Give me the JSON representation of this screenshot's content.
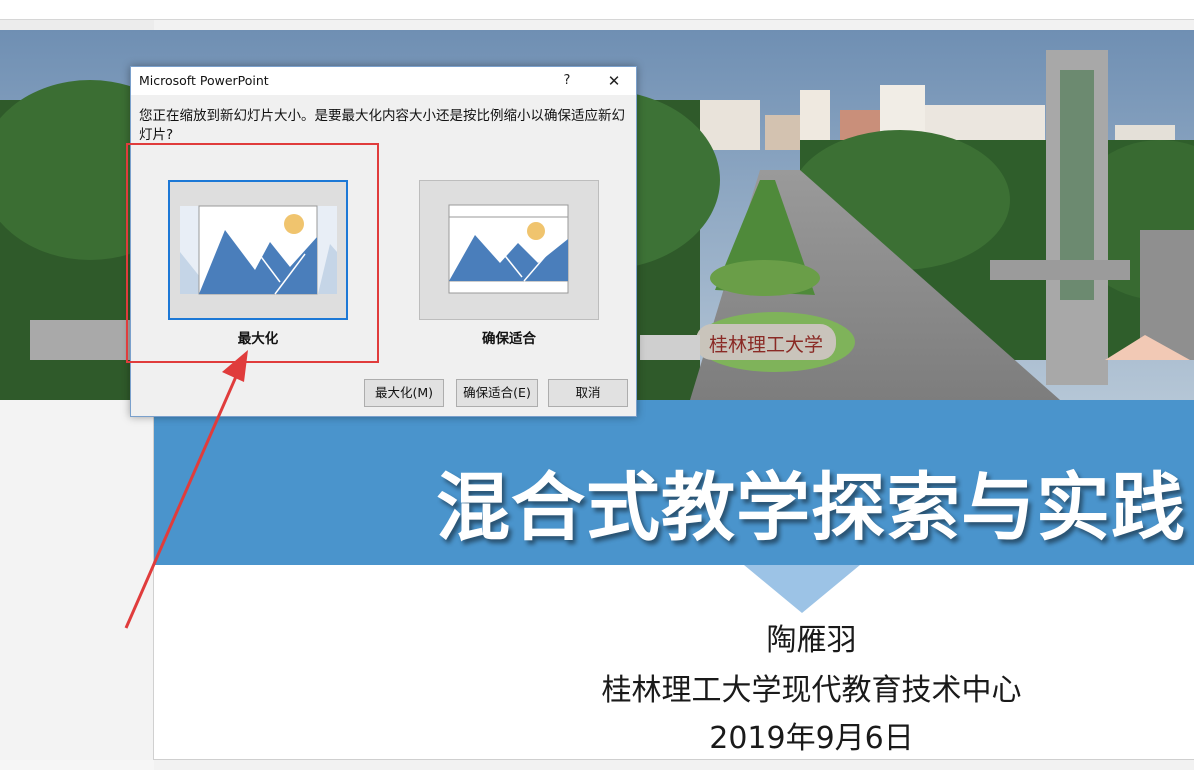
{
  "slide": {
    "title": "混合式教学探索与实践",
    "author": "陶雁羽",
    "organization": "桂林理工大学现代教育技术中心",
    "date": "2019年9月6日",
    "stone_inscription": "桂林理工大学"
  },
  "dialog": {
    "title": "Microsoft PowerPoint",
    "help": "?",
    "close": "✕",
    "message": "您正在缩放到新幻灯片大小。是要最大化内容大小还是按比例缩小以确保适应新幻灯片?",
    "options": [
      {
        "label": "最大化",
        "selected": true
      },
      {
        "label": "确保适合",
        "selected": false
      }
    ],
    "buttons": {
      "maximize": "最大化(M)",
      "ensure_fit": "确保适合(E)",
      "cancel": "取消"
    }
  },
  "colors": {
    "title_band": "#4a94cc",
    "highlight": "#e03c3c",
    "selected_border": "#1c78d6",
    "mountain": "#4a7ebb",
    "sun": "#f0c46e"
  }
}
